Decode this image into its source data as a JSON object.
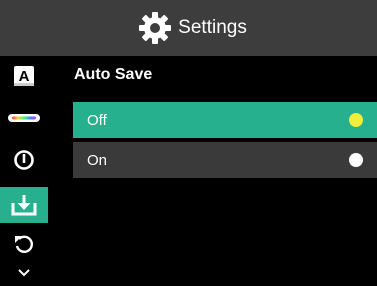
{
  "header": {
    "title": "Settings",
    "icon": "gear-icon"
  },
  "sidebar": {
    "items": [
      {
        "name": "font-icon",
        "label": "A",
        "active": false
      },
      {
        "name": "color-palette-icon",
        "active": false
      },
      {
        "name": "power-icon",
        "active": false
      },
      {
        "name": "auto-save-icon",
        "active": true
      },
      {
        "name": "reset-icon",
        "active": false
      },
      {
        "name": "chevron-down-icon",
        "active": false
      }
    ]
  },
  "main": {
    "section_title": "Auto Save",
    "options": [
      {
        "label": "Off",
        "selected": true
      },
      {
        "label": "On",
        "selected": false
      }
    ]
  },
  "colors": {
    "header_bg": "#3d3d3d",
    "accent": "#27b08d",
    "option_bg": "#3a3a3a",
    "selected_dot": "#f2ee3b",
    "unselected_dot": "#ffffff"
  }
}
